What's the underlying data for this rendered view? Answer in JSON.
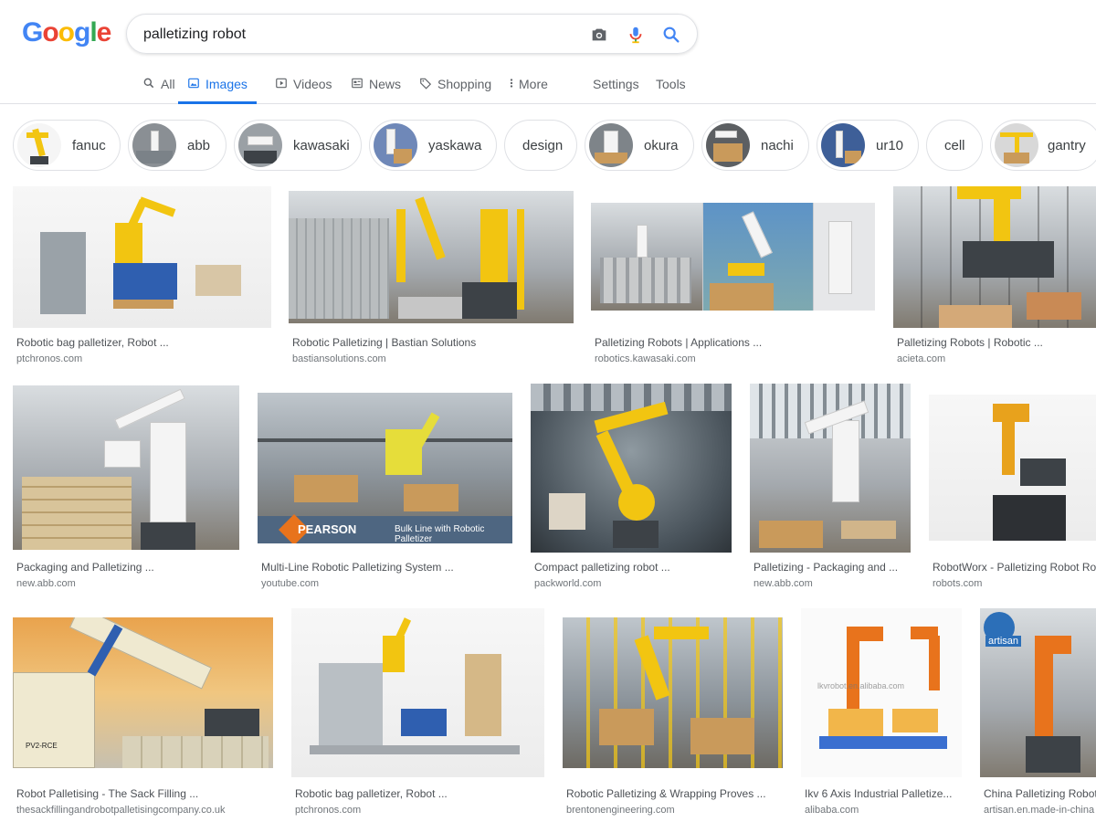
{
  "header": {
    "logo_letters": [
      {
        "ch": "G",
        "color": "#4285f4"
      },
      {
        "ch": "o",
        "color": "#ea4335"
      },
      {
        "ch": "o",
        "color": "#fbbc05"
      },
      {
        "ch": "g",
        "color": "#4285f4"
      },
      {
        "ch": "l",
        "color": "#34a853"
      },
      {
        "ch": "e",
        "color": "#ea4335"
      }
    ],
    "search_query": "palletizing robot",
    "icons": [
      "camera-icon",
      "microphone-icon",
      "search-icon"
    ]
  },
  "tabs": [
    {
      "label": "All",
      "icon": "search-icon",
      "active": false
    },
    {
      "label": "Images",
      "icon": "image-icon",
      "active": true
    },
    {
      "label": "Videos",
      "icon": "video-icon",
      "active": false
    },
    {
      "label": "News",
      "icon": "news-icon",
      "active": false
    },
    {
      "label": "Shopping",
      "icon": "tag-icon",
      "active": false
    },
    {
      "label": "More",
      "icon": "more-vert-icon",
      "active": false
    }
  ],
  "tools": {
    "settings": "Settings",
    "tools": "Tools"
  },
  "chips": [
    {
      "label": "fanuc",
      "has_thumb": true
    },
    {
      "label": "abb",
      "has_thumb": true
    },
    {
      "label": "kawasaki",
      "has_thumb": true
    },
    {
      "label": "yaskawa",
      "has_thumb": true
    },
    {
      "label": "design",
      "has_thumb": false
    },
    {
      "label": "okura",
      "has_thumb": true
    },
    {
      "label": "nachi",
      "has_thumb": true
    },
    {
      "label": "ur10",
      "has_thumb": true
    },
    {
      "label": "cell",
      "has_thumb": false
    },
    {
      "label": "gantry",
      "has_thumb": true
    }
  ],
  "results": [
    {
      "title": "Robotic bag palletizer, Robot ...",
      "source": "ptchronos.com"
    },
    {
      "title": "Robotic Palletizing | Bastian Solutions",
      "source": "bastiansolutions.com"
    },
    {
      "title": "Palletizing Robots | Applications ...",
      "source": "robotics.kawasaki.com"
    },
    {
      "title": "Palletizing Robots | Robotic ...",
      "source": "acieta.com"
    },
    {
      "title": "Packaging and Palletizing ...",
      "source": "new.abb.com"
    },
    {
      "title": "Multi-Line Robotic Palletizing System ...",
      "source": "youtube.com",
      "overlay_brand": "PEARSON",
      "overlay_caption": "Bulk Line with Robotic Palletizer"
    },
    {
      "title": "Compact palletizing robot ...",
      "source": "packworld.com"
    },
    {
      "title": "Palletizing - Packaging and ...",
      "source": "new.abb.com"
    },
    {
      "title": "RobotWorx - Palletizing Robot Robo",
      "source": "robots.com"
    },
    {
      "title": "Robot Palletising - The Sack Filling ...",
      "source": "thesackfillingandrobotpalletisingcompany.co.uk",
      "overlay_label": "PV2-RCE"
    },
    {
      "title": "Robotic bag palletizer, Robot ...",
      "source": "ptchronos.com"
    },
    {
      "title": "Robotic Palletizing & Wrapping Proves ...",
      "source": "brentonengineering.com"
    },
    {
      "title": "Ikv 6 Axis Industrial Palletize...",
      "source": "alibaba.com",
      "overlay_watermark": "lkvrobot.en.alibaba.com"
    },
    {
      "title": "China Palletizing Robot",
      "source": "artisan.en.made-in-china",
      "overlay_brand": "artisan"
    }
  ]
}
